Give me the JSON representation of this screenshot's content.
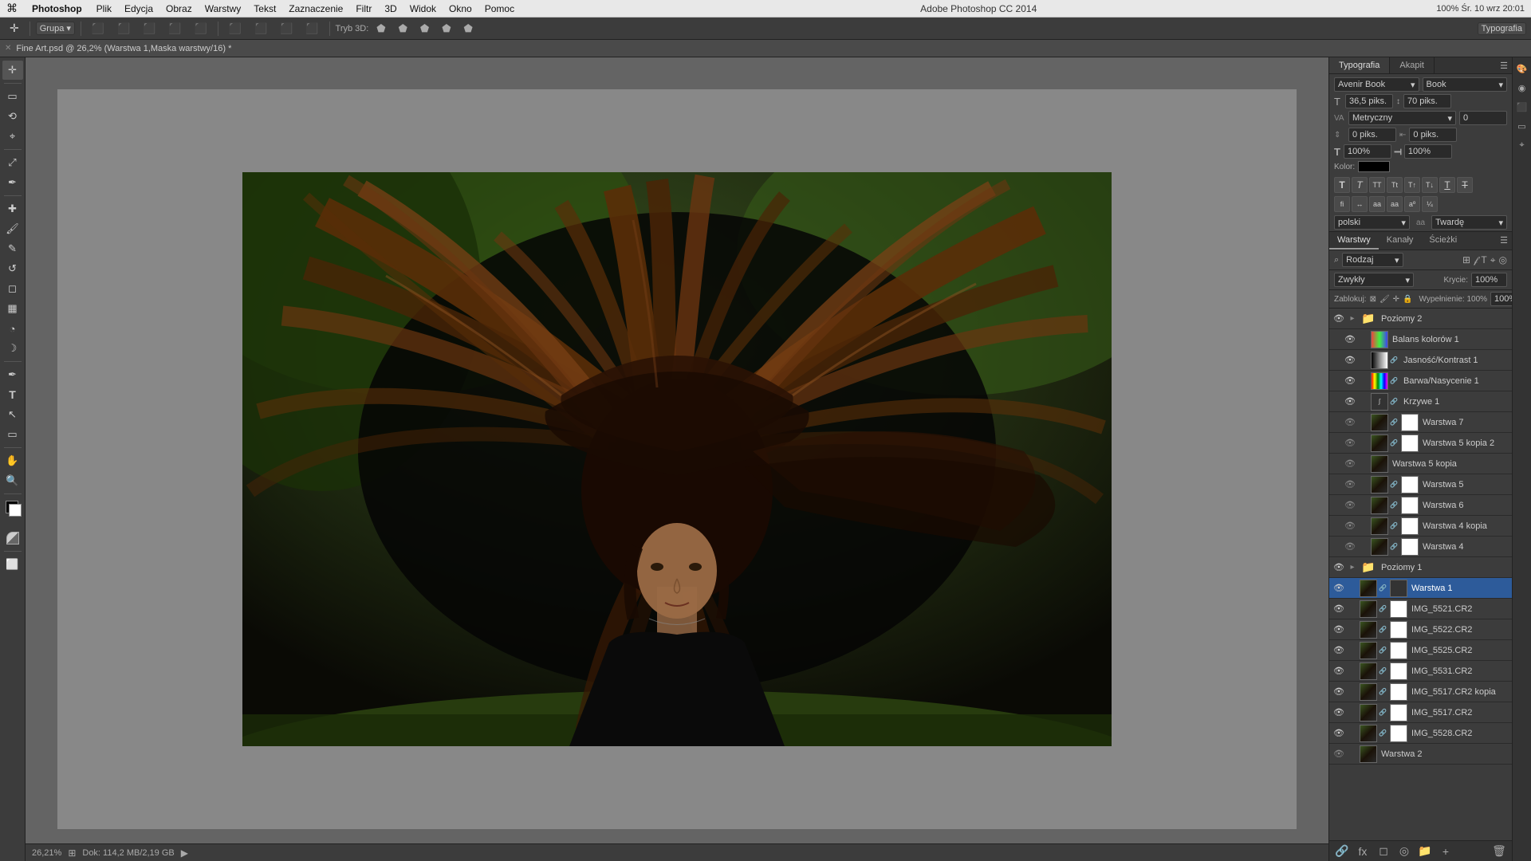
{
  "menubar": {
    "apple": "⌘",
    "appName": "Photoshop",
    "items": [
      "Plik",
      "Edycja",
      "Obraz",
      "Warstwy",
      "Tekst",
      "Zaznaczenie",
      "Filtr",
      "3D",
      "Widok",
      "Okno",
      "Pomoc"
    ],
    "title": "Adobe Photoshop CC 2014",
    "rightInfo": "100%  Śr. 10 wrz  20:01"
  },
  "toolbar": {
    "groupLabel": "Grupa",
    "mode3d": "Tryb 3D:",
    "workspace": "Typografia"
  },
  "fileTab": {
    "label": "Fine Art.psd @ 26,2% (Warstwa 1,Maska warstwy/16) *"
  },
  "statusBar": {
    "zoom": "26,21%",
    "docSize": "Dok: 114,2 MB/2,19 GB"
  },
  "typoPanel": {
    "tabs": [
      "Typografia",
      "Akapit"
    ],
    "fontFamily": "Avenir Book",
    "fontStyle": "Book",
    "fontSize": "36,5 piks.",
    "leading": "70 piks.",
    "tracking": "0",
    "kerningLabel": "Metryczny",
    "kerningVal": "0 piks.",
    "scaleH": "100%",
    "scaleV": "100%",
    "colorLabel": "Kolor:",
    "langLabel": "polski",
    "antiAlias": "Twardę",
    "formatBtns": [
      "T",
      "T",
      "T",
      "T",
      "T",
      "T",
      "T",
      "T"
    ]
  },
  "layersPanel": {
    "tabs": [
      "Warstwy",
      "Kanały",
      "Ścieżki"
    ],
    "searchPlaceholder": "Rodzaj",
    "blendMode": "Zwykły",
    "opacity": "100%",
    "fill": "Wypełnienie: 100%",
    "lockLabel": "Zablokuj:",
    "layers": [
      {
        "id": "poziomy2",
        "name": "Poziomy 2",
        "type": "group",
        "indent": 0,
        "visible": true,
        "locked": false,
        "hasChain": false,
        "thumbType": "folder"
      },
      {
        "id": "balans1",
        "name": "Balans kolorów 1",
        "type": "adj",
        "indent": 1,
        "visible": true,
        "locked": false,
        "hasChain": false,
        "thumbType": "balans"
      },
      {
        "id": "jasnosc",
        "name": "Jasność/Kontrast 1",
        "type": "adj",
        "indent": 1,
        "visible": true,
        "locked": false,
        "hasChain": true,
        "thumbType": "levels"
      },
      {
        "id": "barwa",
        "name": "Barwa/Nasycenie 1",
        "type": "adj",
        "indent": 1,
        "visible": true,
        "locked": false,
        "hasChain": true,
        "thumbType": "hue"
      },
      {
        "id": "krzywe",
        "name": "Krzywe 1",
        "type": "adj",
        "indent": 1,
        "visible": true,
        "locked": false,
        "hasChain": true,
        "thumbType": "curves"
      },
      {
        "id": "warstwa7",
        "name": "Warstwa 7",
        "type": "layer",
        "indent": 1,
        "visible": false,
        "locked": false,
        "hasChain": true,
        "thumbType": "photo"
      },
      {
        "id": "warstwa5kopia2",
        "name": "Warstwa 5 kopia 2",
        "type": "layer",
        "indent": 1,
        "visible": false,
        "locked": false,
        "hasChain": true,
        "thumbType": "photo"
      },
      {
        "id": "warstwa5kopia",
        "name": "Warstwa 5 kopia",
        "type": "layer",
        "indent": 1,
        "visible": false,
        "locked": false,
        "hasChain": false,
        "thumbType": "photo"
      },
      {
        "id": "warstwa5",
        "name": "Warstwa 5",
        "type": "layer",
        "indent": 1,
        "visible": false,
        "locked": false,
        "hasChain": true,
        "thumbType": "photo"
      },
      {
        "id": "warstwa6",
        "name": "Warstwa 6",
        "type": "layer",
        "indent": 1,
        "visible": false,
        "locked": false,
        "hasChain": true,
        "thumbType": "photo"
      },
      {
        "id": "warstwa4kopia",
        "name": "Warstwa 4 kopia",
        "type": "layer",
        "indent": 1,
        "visible": false,
        "locked": false,
        "hasChain": true,
        "thumbType": "photo"
      },
      {
        "id": "warstwa4",
        "name": "Warstwa 4",
        "type": "layer",
        "indent": 1,
        "visible": false,
        "locked": false,
        "hasChain": true,
        "thumbType": "photo"
      },
      {
        "id": "poziomy1",
        "name": "Poziomy 1",
        "type": "group",
        "indent": 0,
        "visible": true,
        "locked": false,
        "hasChain": false,
        "thumbType": "folder"
      },
      {
        "id": "warstwa1",
        "name": "Warstwa 1",
        "type": "layer",
        "indent": 0,
        "visible": true,
        "locked": false,
        "hasChain": true,
        "thumbType": "photo",
        "selected": true
      },
      {
        "id": "img5521",
        "name": "IMG_5521.CR2",
        "type": "layer",
        "indent": 0,
        "visible": true,
        "locked": false,
        "hasChain": true,
        "thumbType": "photo"
      },
      {
        "id": "img5522",
        "name": "IMG_5522.CR2",
        "type": "layer",
        "indent": 0,
        "visible": true,
        "locked": false,
        "hasChain": true,
        "thumbType": "photo"
      },
      {
        "id": "img5525",
        "name": "IMG_5525.CR2",
        "type": "layer",
        "indent": 0,
        "visible": true,
        "locked": false,
        "hasChain": true,
        "thumbType": "photo"
      },
      {
        "id": "img5531",
        "name": "IMG_5531.CR2",
        "type": "layer",
        "indent": 0,
        "visible": true,
        "locked": false,
        "hasChain": true,
        "thumbType": "photo"
      },
      {
        "id": "img5517kopia",
        "name": "IMG_5517.CR2 kopia",
        "type": "layer",
        "indent": 0,
        "visible": true,
        "locked": false,
        "hasChain": true,
        "thumbType": "photo"
      },
      {
        "id": "img5517",
        "name": "IMG_5517.CR2",
        "type": "layer",
        "indent": 0,
        "visible": true,
        "locked": false,
        "hasChain": true,
        "thumbType": "photo"
      },
      {
        "id": "img5528",
        "name": "IMG_5528.CR2",
        "type": "layer",
        "indent": 0,
        "visible": true,
        "locked": false,
        "hasChain": true,
        "thumbType": "photo"
      },
      {
        "id": "warstwa2",
        "name": "Warstwa 2",
        "type": "layer",
        "indent": 0,
        "visible": false,
        "locked": false,
        "hasChain": false,
        "thumbType": "photo"
      }
    ],
    "bottomBtns": [
      "🔗",
      "⊞",
      "𝒻",
      "◎",
      "🗑"
    ]
  },
  "tools": {
    "items": [
      "↔",
      "▢",
      "⟲",
      "✂",
      "⌖",
      "✏",
      "🖌",
      "🖊",
      "⟜",
      "A",
      "▭",
      "⬟",
      "✋",
      "◎",
      "🔍",
      "✿",
      "☰",
      "⬛"
    ]
  }
}
